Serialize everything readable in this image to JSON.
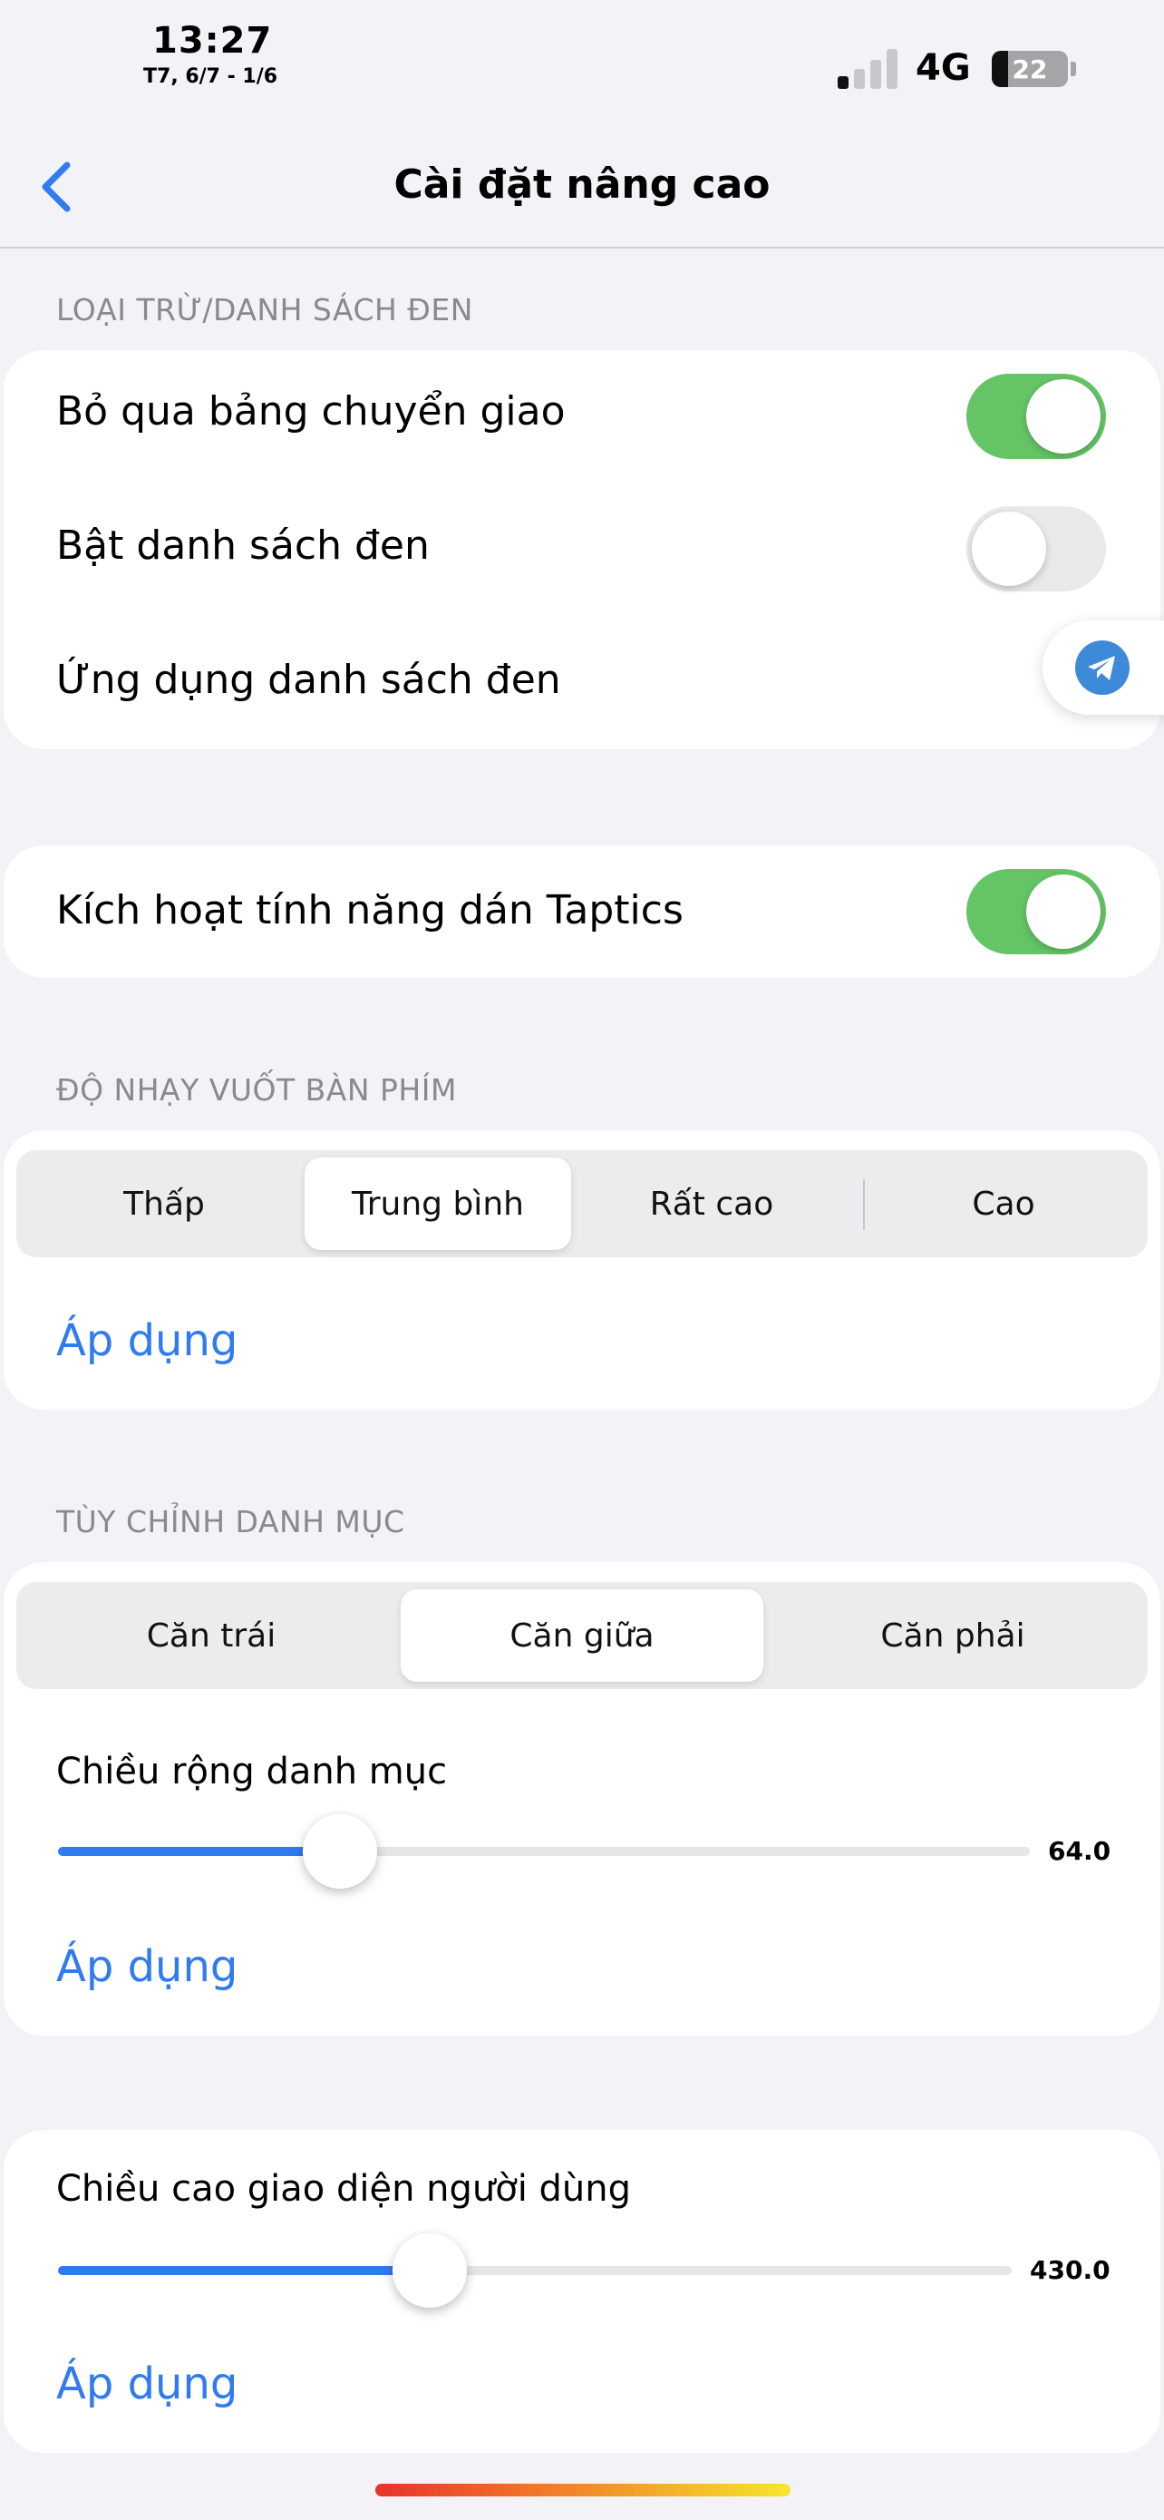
{
  "status_bar": {
    "time": "13:27",
    "date": "T7, 6/7 - 1/6",
    "network": "4G",
    "battery": "22"
  },
  "nav": {
    "back_icon": "chevron-left-icon",
    "title": "Cài đặt nâng cao"
  },
  "blacklist_section": {
    "header": "LOẠI TRỪ/DANH SÁCH ĐEN",
    "rows": [
      {
        "label": "Bỏ qua bảng chuyển giao",
        "toggle": true
      },
      {
        "label": "Bật danh sách đen",
        "toggle": false
      },
      {
        "label": "Ứng dụng danh sách đen"
      }
    ]
  },
  "taptics": {
    "label": "Kích hoạt tính năng dán Taptics",
    "toggle": true
  },
  "swipe_sensitivity": {
    "header": "ĐỘ NHẠY VUỐT BÀN PHÍM",
    "options": [
      "Thấp",
      "Trung bình",
      "Rất cao",
      "Cao"
    ],
    "selected": "Trung bình",
    "apply_label": "Áp dụng"
  },
  "category_custom": {
    "header": "TÙY CHỈNH DANH MỤC",
    "options": [
      "Căn trái",
      "Căn giữa",
      "Căn phải"
    ],
    "selected": "Căn giữa",
    "width_label": "Chiều rộng danh mục",
    "width_value": "64.0",
    "width_fraction": 0.29,
    "apply_label": "Áp dụng"
  },
  "ui_height": {
    "label": "Chiều cao giao diện người dùng",
    "value": "430.0",
    "fraction": 0.39,
    "apply_label": "Áp dụng"
  },
  "colors": {
    "accent": "#2f7bf2",
    "toggle_on": "#64c466",
    "background": "#f2f2f7"
  }
}
